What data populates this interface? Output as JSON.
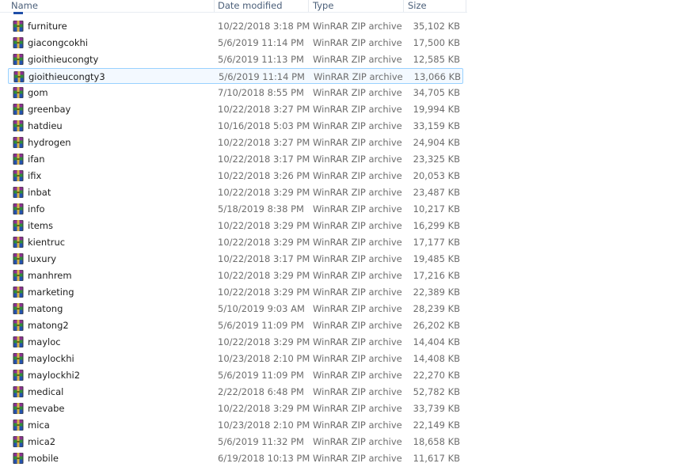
{
  "columns": {
    "name": "Name",
    "date": "Date modified",
    "type": "Type",
    "size": "Size"
  },
  "icon_name": "winrar-archive-icon",
  "selected_index": 3,
  "colors": {
    "selection_border": "#99d1ff",
    "selection_fill": "#f3f9ff",
    "header_text": "#4c607a"
  },
  "files": [
    {
      "name": "furniture",
      "date": "10/22/2018 3:18 PM",
      "type": "WinRAR ZIP archive",
      "size": "35,102 KB"
    },
    {
      "name": "giacongcokhi",
      "date": "5/6/2019 11:14 PM",
      "type": "WinRAR ZIP archive",
      "size": "17,500 KB"
    },
    {
      "name": "gioithieucongty",
      "date": "5/6/2019 11:13 PM",
      "type": "WinRAR ZIP archive",
      "size": "12,585 KB"
    },
    {
      "name": "gioithieucongty3",
      "date": "5/6/2019 11:14 PM",
      "type": "WinRAR ZIP archive",
      "size": "13,066 KB"
    },
    {
      "name": "gom",
      "date": "7/10/2018 8:55 PM",
      "type": "WinRAR ZIP archive",
      "size": "34,705 KB"
    },
    {
      "name": "greenbay",
      "date": "10/22/2018 3:27 PM",
      "type": "WinRAR ZIP archive",
      "size": "19,994 KB"
    },
    {
      "name": "hatdieu",
      "date": "10/16/2018 5:03 PM",
      "type": "WinRAR ZIP archive",
      "size": "33,159 KB"
    },
    {
      "name": "hydrogen",
      "date": "10/22/2018 3:27 PM",
      "type": "WinRAR ZIP archive",
      "size": "24,904 KB"
    },
    {
      "name": "ifan",
      "date": "10/22/2018 3:17 PM",
      "type": "WinRAR ZIP archive",
      "size": "23,325 KB"
    },
    {
      "name": "ifix",
      "date": "10/22/2018 3:26 PM",
      "type": "WinRAR ZIP archive",
      "size": "20,053 KB"
    },
    {
      "name": "inbat",
      "date": "10/22/2018 3:29 PM",
      "type": "WinRAR ZIP archive",
      "size": "23,487 KB"
    },
    {
      "name": "info",
      "date": "5/18/2019 8:38 PM",
      "type": "WinRAR ZIP archive",
      "size": "10,217 KB"
    },
    {
      "name": "items",
      "date": "10/22/2018 3:29 PM",
      "type": "WinRAR ZIP archive",
      "size": "16,299 KB"
    },
    {
      "name": "kientruc",
      "date": "10/22/2018 3:29 PM",
      "type": "WinRAR ZIP archive",
      "size": "17,177 KB"
    },
    {
      "name": "luxury",
      "date": "10/22/2018 3:17 PM",
      "type": "WinRAR ZIP archive",
      "size": "19,485 KB"
    },
    {
      "name": "manhrem",
      "date": "10/22/2018 3:29 PM",
      "type": "WinRAR ZIP archive",
      "size": "17,216 KB"
    },
    {
      "name": "marketing",
      "date": "10/22/2018 3:29 PM",
      "type": "WinRAR ZIP archive",
      "size": "22,389 KB"
    },
    {
      "name": "matong",
      "date": "5/10/2019 9:03 AM",
      "type": "WinRAR ZIP archive",
      "size": "28,239 KB"
    },
    {
      "name": "matong2",
      "date": "5/6/2019 11:09 PM",
      "type": "WinRAR ZIP archive",
      "size": "26,202 KB"
    },
    {
      "name": "mayloc",
      "date": "10/22/2018 3:29 PM",
      "type": "WinRAR ZIP archive",
      "size": "14,404 KB"
    },
    {
      "name": "maylockhi",
      "date": "10/23/2018 2:10 PM",
      "type": "WinRAR ZIP archive",
      "size": "14,408 KB"
    },
    {
      "name": "maylockhi2",
      "date": "5/6/2019 11:09 PM",
      "type": "WinRAR ZIP archive",
      "size": "22,270 KB"
    },
    {
      "name": "medical",
      "date": "2/22/2018 6:48 PM",
      "type": "WinRAR ZIP archive",
      "size": "52,782 KB"
    },
    {
      "name": "mevabe",
      "date": "10/22/2018 3:29 PM",
      "type": "WinRAR ZIP archive",
      "size": "33,739 KB"
    },
    {
      "name": "mica",
      "date": "10/23/2018 2:10 PM",
      "type": "WinRAR ZIP archive",
      "size": "22,149 KB"
    },
    {
      "name": "mica2",
      "date": "5/6/2019 11:32 PM",
      "type": "WinRAR ZIP archive",
      "size": "18,658 KB"
    },
    {
      "name": "mobile",
      "date": "6/19/2018 10:13 PM",
      "type": "WinRAR ZIP archive",
      "size": "11,617 KB"
    }
  ]
}
